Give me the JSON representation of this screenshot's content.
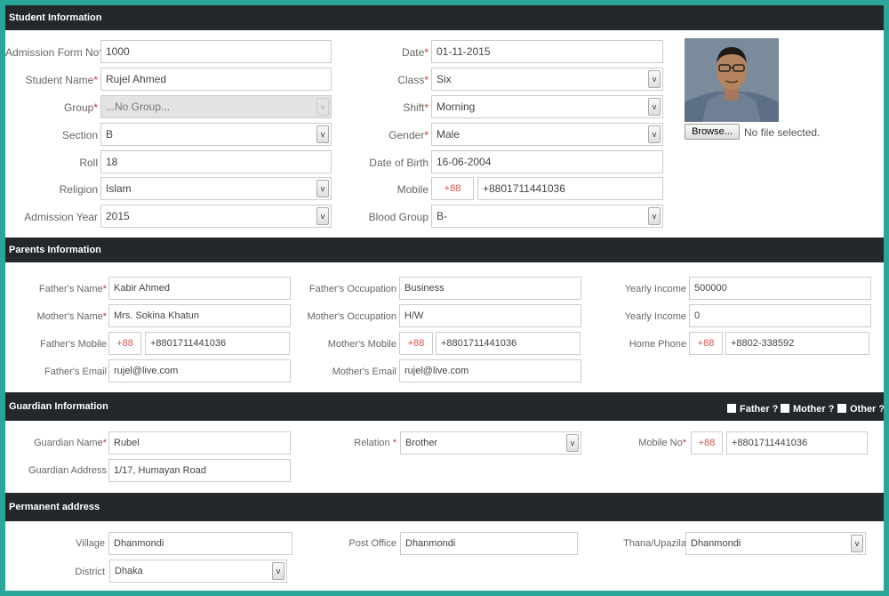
{
  "student": {
    "header": "Student Information",
    "admission_form_no": {
      "label": "Admission Form No",
      "value": "1000"
    },
    "student_name": {
      "label": "Student Name",
      "value": "Rujel Ahmed"
    },
    "group": {
      "label": "Group",
      "value": "...No Group..."
    },
    "section": {
      "label": "Section",
      "value": "B"
    },
    "roll": {
      "label": "Roll",
      "value": "18"
    },
    "religion": {
      "label": "Religion",
      "value": "Islam"
    },
    "admission_year": {
      "label": "Admission Year",
      "value": "2015"
    },
    "date": {
      "label": "Date",
      "value": "01-11-2015"
    },
    "class": {
      "label": "Class",
      "value": "Six"
    },
    "shift": {
      "label": "Shift",
      "value": "Morning"
    },
    "gender": {
      "label": "Gender",
      "value": "Male"
    },
    "dob": {
      "label": "Date of Birth",
      "value": "16-06-2004"
    },
    "mobile": {
      "label": "Mobile",
      "prefix": "+88",
      "value": "+8801711441036"
    },
    "blood_group": {
      "label": "Blood Group",
      "value": "B-"
    },
    "photo": {
      "browse": "Browse...",
      "status": "No file selected."
    }
  },
  "parents": {
    "header": "Parents Information",
    "father_name": {
      "label": "Father's Name",
      "value": "Kabir Ahmed"
    },
    "mother_name": {
      "label": "Mother's Name",
      "value": "Mrs. Sokina Khatun"
    },
    "father_mobile": {
      "label": "Father's Mobile",
      "prefix": "+88",
      "value": "+8801711441036"
    },
    "father_email": {
      "label": "Father's Email",
      "value": "rujel@live.com"
    },
    "father_occupation": {
      "label": "Father's Occupation",
      "value": "Business"
    },
    "mother_occupation": {
      "label": "Mother's Occupation",
      "value": "H/W"
    },
    "mother_mobile": {
      "label": "Mother's Mobile",
      "prefix": "+88",
      "value": "+8801711441036"
    },
    "mother_email": {
      "label": "Mother's Email",
      "value": "rujel@live.com"
    },
    "yearly_income_1": {
      "label": "Yearly Income",
      "value": "500000"
    },
    "yearly_income_2": {
      "label": "Yearly Income",
      "value": "0"
    },
    "home_phone": {
      "label": "Home Phone",
      "prefix": "+88",
      "value": "+8802-338592"
    }
  },
  "guardian": {
    "header": "Guardian Information",
    "father_chk": "Father ?",
    "mother_chk": "Mother ?",
    "other_chk": "Other ?",
    "name": {
      "label": "Guardian Name",
      "value": "Rubel"
    },
    "address": {
      "label": "Guardian Address",
      "value": "1/17, Humayan Road"
    },
    "relation": {
      "label": "Relation ",
      "value": "Brother"
    },
    "mobile": {
      "label": "Mobile No",
      "prefix": "+88",
      "value": "+8801711441036"
    }
  },
  "permanent": {
    "header": "Permanent address",
    "village": {
      "label": "Village",
      "value": "Dhanmondi"
    },
    "post_office": {
      "label": "Post Office",
      "value": "Dhanmondi"
    },
    "thana": {
      "label": "Thana/Upazila",
      "value": "Dhanmondi"
    },
    "district": {
      "label": "District",
      "value": "Dhaka"
    }
  },
  "select_arrow": "v",
  "required_mark": "*"
}
